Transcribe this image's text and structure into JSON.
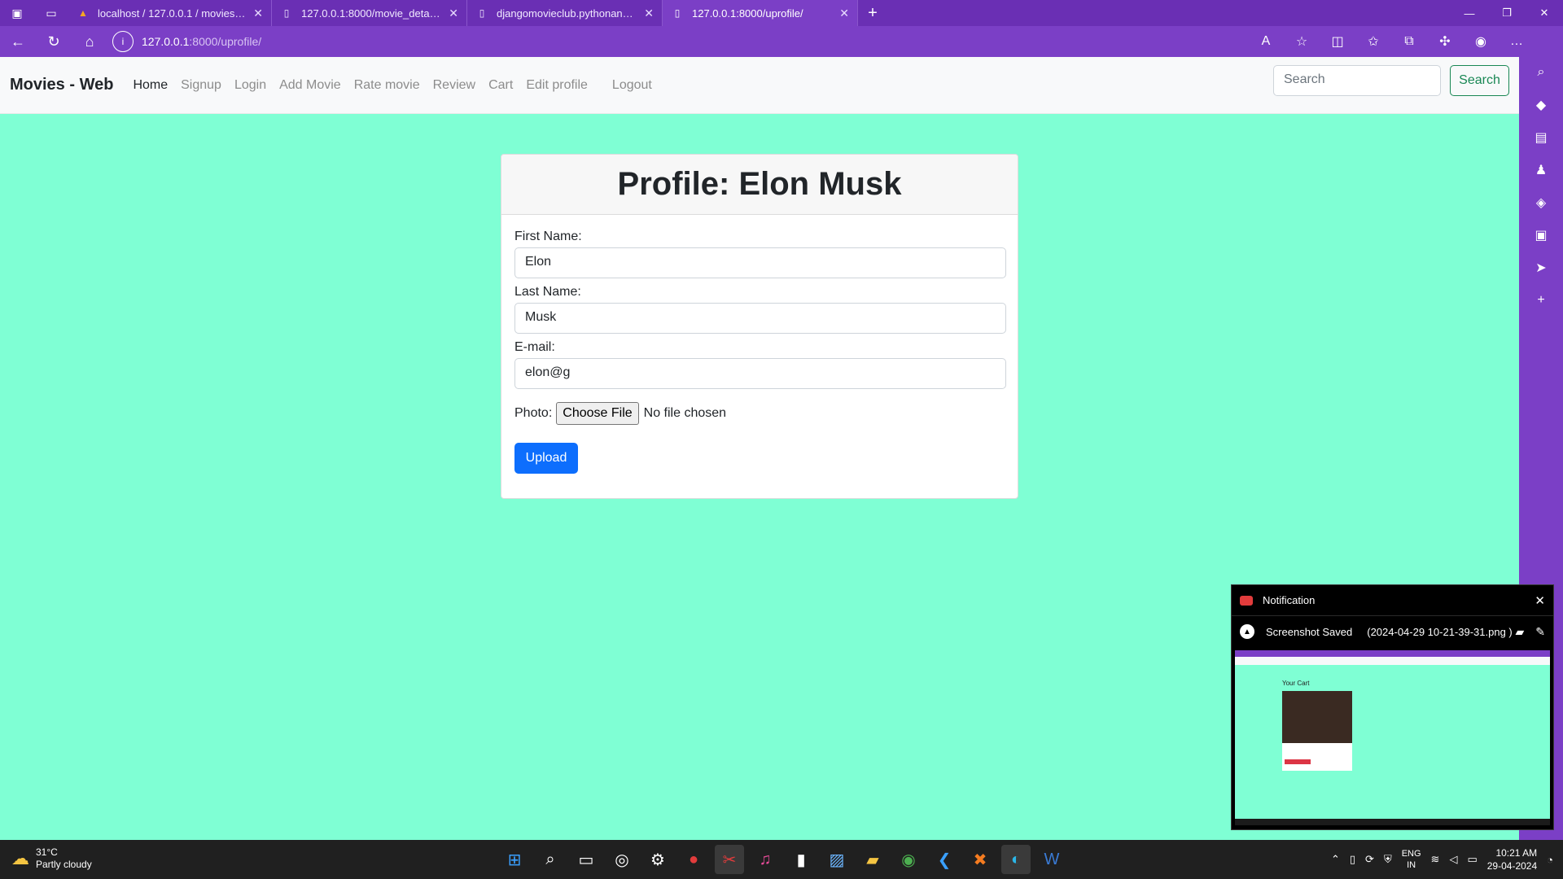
{
  "browser": {
    "tabs": [
      {
        "title": "localhost / 127.0.0.1 / movies_db",
        "icon": "phpmyadmin-icon",
        "active": false
      },
      {
        "title": "127.0.0.1:8000/movie_details/",
        "icon": "page-icon",
        "active": false
      },
      {
        "title": "djangomovieclub.pythonanywhere",
        "icon": "page-icon",
        "active": false
      },
      {
        "title": "127.0.0.1:8000/uprofile/",
        "icon": "page-icon",
        "active": true
      }
    ],
    "url_host": "127.0.0.1",
    "url_path": ":8000/uprofile/"
  },
  "navbar": {
    "brand": "Movies - Web",
    "links": [
      "Home",
      "Signup",
      "Login",
      "Add Movie",
      "Rate movie",
      "Review",
      "Cart",
      "Edit profile"
    ],
    "logout": "Logout",
    "search_placeholder": "Search",
    "search_button": "Search"
  },
  "profile": {
    "title": "Profile: Elon Musk",
    "first_name_label": "First Name:",
    "first_name_value": "Elon",
    "last_name_label": "Last Name:",
    "last_name_value": "Musk",
    "email_label": "E-mail:",
    "email_value": "elon@g",
    "photo_label": "Photo:",
    "choose_file": "Choose File",
    "no_file": "No file chosen",
    "upload_button": "Upload"
  },
  "notification": {
    "title": "Notification",
    "status": "Screenshot Saved",
    "filename": "(2024-04-29 10-21-39-31.png )",
    "thumb_label": "Your Cart"
  },
  "taskbar": {
    "temperature": "31°C",
    "weather": "Partly cloudy",
    "lang_top": "ENG",
    "lang_bottom": "IN",
    "time": "10:21 AM",
    "date": "29-04-2024"
  },
  "colors": {
    "page_bg": "#7fffd4",
    "browser_purple": "#7b3fc6",
    "upload_blue": "#0d6efd",
    "search_green": "#198754"
  }
}
